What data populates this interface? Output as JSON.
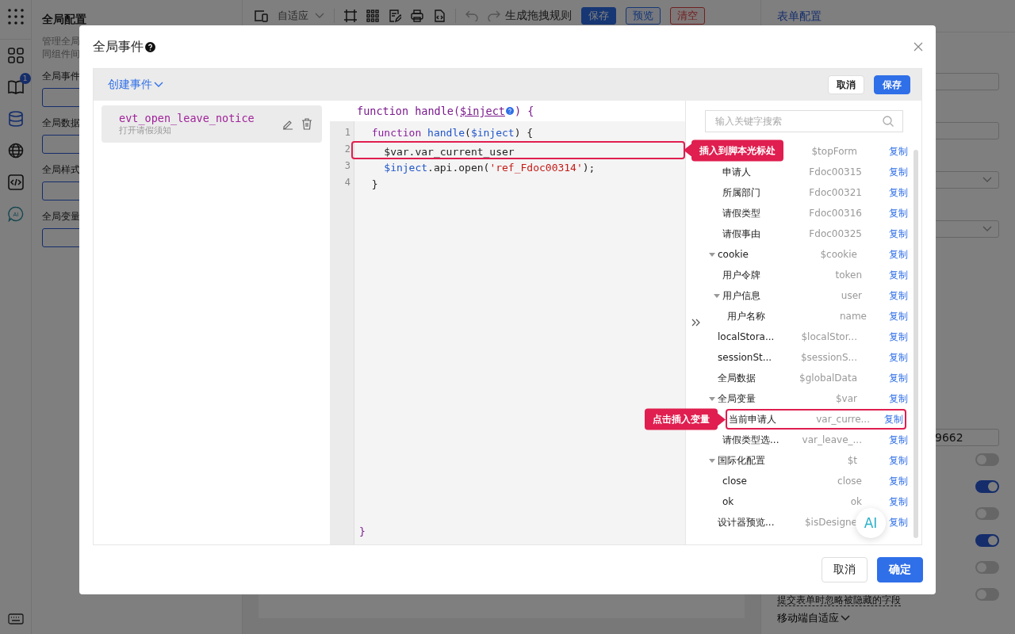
{
  "app": {
    "rail_badge": "1",
    "rail_ai_label": "AI",
    "config_panel": {
      "title": "全局配置",
      "description_lines": [
        "管理全局",
        "同组件间"
      ],
      "fields": [
        "全局事件",
        "全局数据",
        "全局样式",
        "全局变量"
      ]
    },
    "toolbar": {
      "device_select": "自适应",
      "generate_rule": "生成拖拽规则",
      "buttons": [
        {
          "kind": "save",
          "label": "保存"
        },
        {
          "kind": "preview",
          "label": "预览"
        },
        {
          "kind": "clear",
          "label": "清空"
        }
      ]
    },
    "right_panel": {
      "title": "表单配置",
      "input_value": "9662",
      "switches": [
        {
          "on": false
        },
        {
          "on": true
        },
        {
          "on": false
        },
        {
          "on": true
        },
        {
          "on": false
        },
        {
          "on": false,
          "label": "提交表单时忽略被隐藏的字段"
        }
      ],
      "mobile_adapt": "移动端自适应"
    }
  },
  "dialog": {
    "title": "全局事件",
    "create_event": "创建事件",
    "header_buttons": [
      {
        "kind": "default",
        "label": "取消"
      },
      {
        "kind": "primary",
        "label": "保存"
      }
    ],
    "events": [
      {
        "name": "evt_open_leave_notice",
        "description": "打开请假须知",
        "selected": true
      }
    ],
    "signature": {
      "before": "function handle(",
      "param": "$inject",
      "after": ") {"
    },
    "code_lines": [
      {
        "number": "1",
        "highlighted": false,
        "tokens": [
          {
            "kind": "keyword",
            "text": "  function "
          },
          {
            "kind": "fn",
            "text": "handle"
          },
          {
            "kind": "plain",
            "text": "("
          },
          {
            "kind": "var",
            "text": "$inject"
          },
          {
            "kind": "plain",
            "text": ") {"
          }
        ]
      },
      {
        "number": "2",
        "highlighted": true,
        "callout": "插入到脚本光标处",
        "tokens": [
          {
            "kind": "plain",
            "text": "    $var.var_current_user"
          }
        ]
      },
      {
        "number": "3",
        "highlighted": false,
        "tokens": [
          {
            "kind": "var",
            "text": "    $inject"
          },
          {
            "kind": "plain",
            "text": ".api.open("
          },
          {
            "kind": "string",
            "text": "'ref_Fdoc00314'"
          },
          {
            "kind": "plain",
            "text": ");"
          }
        ]
      },
      {
        "number": "4",
        "highlighted": false,
        "tokens": [
          {
            "kind": "plain",
            "text": "  }"
          }
        ]
      }
    ],
    "closing": "}",
    "search": {
      "placeholder": "输入关键字搜索"
    },
    "variables": [
      {
        "value": "$topForm",
        "action": "复制",
        "expanded": true,
        "children": [
          {
            "name": "申请人",
            "value": "Fdoc00315",
            "action": "复制"
          },
          {
            "name": "所属部门",
            "value": "Fdoc00321",
            "action": "复制"
          },
          {
            "name": "请假类型",
            "value": "Fdoc00316",
            "action": "复制"
          },
          {
            "name": "请假事由",
            "value": "Fdoc00325",
            "action": "复制"
          }
        ]
      },
      {
        "name": "cookie",
        "value": "$cookie",
        "action": "复制",
        "expanded": true,
        "children": [
          {
            "name": "用户令牌",
            "value": "token",
            "action": "复制"
          },
          {
            "name": "用户信息",
            "value": "user",
            "action": "复制",
            "expanded": true,
            "children": [
              {
                "name": "用户名称",
                "value": "name",
                "action": "复制"
              }
            ]
          }
        ]
      },
      {
        "name": "localStora...",
        "value": "$localStor...",
        "action": "复制"
      },
      {
        "name": "sessionSt...",
        "value": "$sessionS...",
        "action": "复制"
      },
      {
        "name": "全局数据",
        "value": "$globalData",
        "action": "复制"
      },
      {
        "name": "全局变量",
        "value": "$var",
        "action": "复制",
        "expanded": true,
        "children": [
          {
            "name": "当前申请人",
            "value": "var_curre...",
            "action": "复制",
            "highlighted": true,
            "callout": "点击插入变量"
          },
          {
            "name": "请假类型选...",
            "value": "var_leave_...",
            "action": "复制"
          }
        ]
      },
      {
        "name": "国际化配置",
        "value": "$t",
        "action": "复制",
        "expanded": true,
        "children": [
          {
            "name": "close",
            "value": "close",
            "action": "复制"
          },
          {
            "name": "ok",
            "value": "ok",
            "action": "复制"
          }
        ]
      },
      {
        "name": "设计器预览...",
        "value": "$isDesigne",
        "action": "复制"
      }
    ],
    "ai_button": "AI",
    "footer_buttons": [
      {
        "kind": "default",
        "label": "取消"
      },
      {
        "kind": "primary",
        "label": "确定"
      }
    ]
  }
}
